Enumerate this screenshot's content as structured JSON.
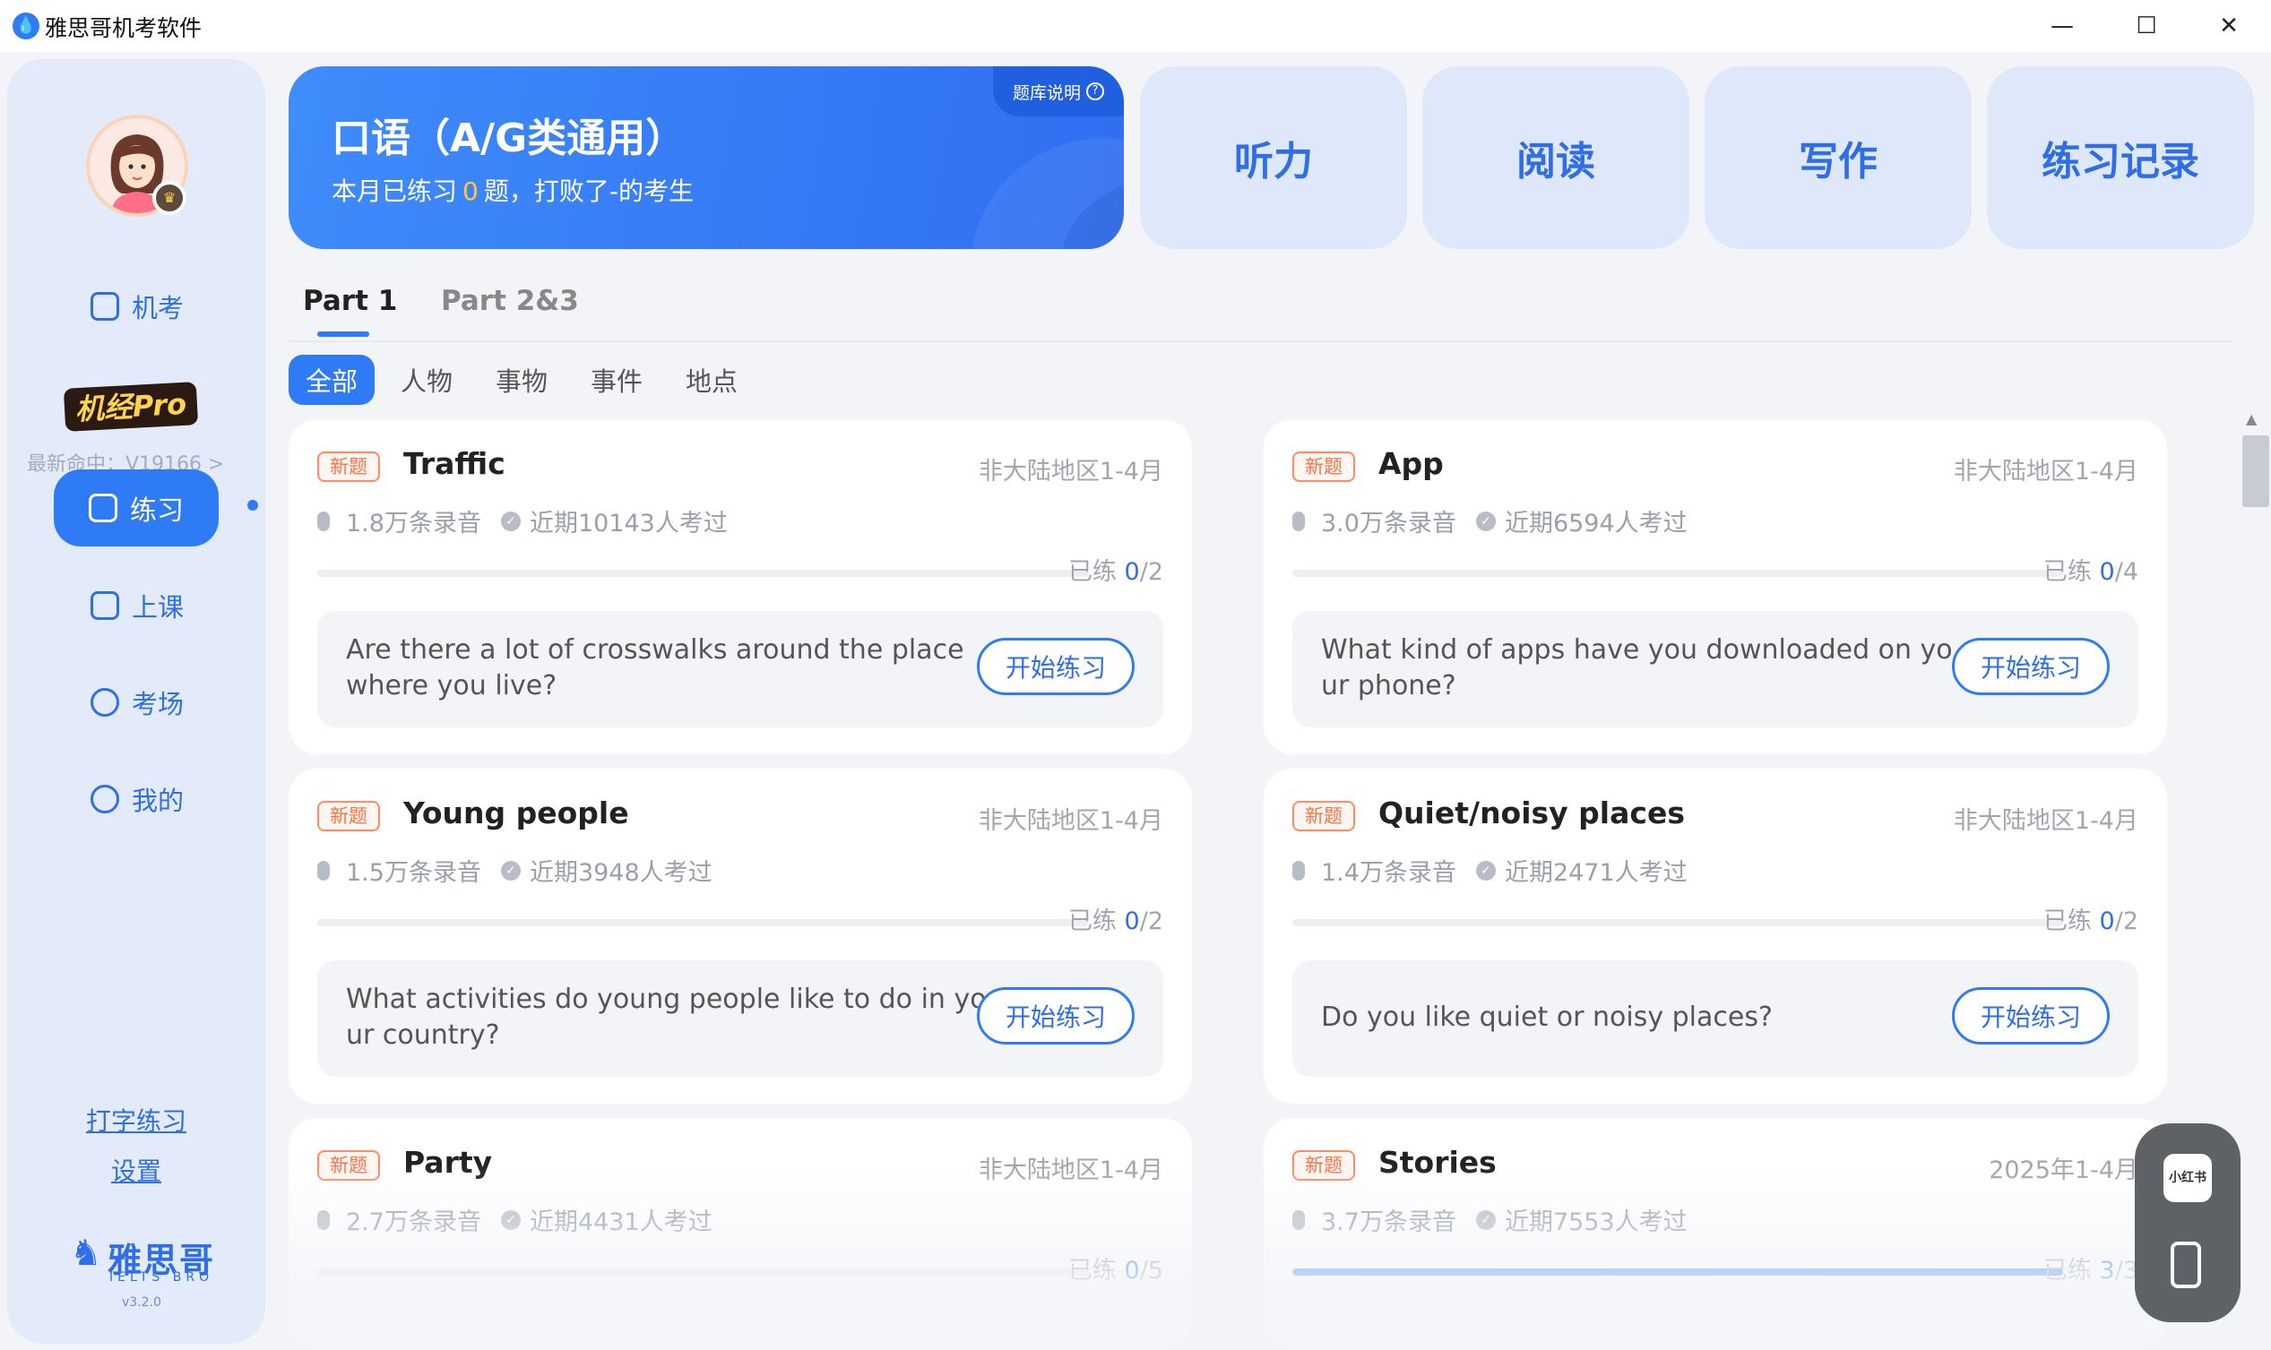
{
  "window": {
    "title": "雅思哥机考软件",
    "minimize": "—",
    "maximize": "☐",
    "close": "✕"
  },
  "sidebar": {
    "nav": [
      {
        "label": "机考",
        "icon": "monitor-icon"
      },
      {
        "label": "练习",
        "icon": "edit-icon",
        "active": true
      },
      {
        "label": "上课",
        "icon": "tv-icon"
      },
      {
        "label": "考场",
        "icon": "chat-icon"
      },
      {
        "label": "我的",
        "icon": "smile-icon"
      }
    ],
    "pro_logo": "机经Pro",
    "latest_hit": "最新命中：V19166 >",
    "links": {
      "typing": "打字练习",
      "settings": "设置"
    },
    "brand": {
      "name": "雅思哥",
      "sub": "IELTS BRO",
      "version": "v3.2.0"
    }
  },
  "hero": {
    "title": "口语（A/G类通用）",
    "sub_prefix": "本月已练习",
    "count": "0",
    "sub_suffix": "题，打败了-的考生",
    "help": "题库说明"
  },
  "categories": [
    "听力",
    "阅读",
    "写作",
    "练习记录"
  ],
  "tabs": [
    "Part 1",
    "Part 2&3"
  ],
  "filters": [
    "全部",
    "人物",
    "事物",
    "事件",
    "地点"
  ],
  "cards": [
    {
      "tag": "新题",
      "title": "Traffic",
      "region": "非大陆地区1-4月",
      "recordings": "1.8万条录音",
      "takers": "近期10143人考过",
      "done_label": "已练 ",
      "done": "0",
      "total": "/2",
      "progress": 0,
      "question": "Are there a lot of crosswalks around the place where you live?",
      "button": "开始练习"
    },
    {
      "tag": "新题",
      "title": "App",
      "region": "非大陆地区1-4月",
      "recordings": "3.0万条录音",
      "takers": "近期6594人考过",
      "done_label": "已练 ",
      "done": "0",
      "total": "/4",
      "progress": 0,
      "question": "What kind of apps have you downloaded on your phone?",
      "button": "开始练习"
    },
    {
      "tag": "新题",
      "title": "Young people",
      "region": "非大陆地区1-4月",
      "recordings": "1.5万条录音",
      "takers": "近期3948人考过",
      "done_label": "已练 ",
      "done": "0",
      "total": "/2",
      "progress": 0,
      "question": "What activities do young people like to do in your country?",
      "button": "开始练习"
    },
    {
      "tag": "新题",
      "title": "Quiet/noisy places",
      "region": "非大陆地区1-4月",
      "recordings": "1.4万条录音",
      "takers": "近期2471人考过",
      "done_label": "已练 ",
      "done": "0",
      "total": "/2",
      "progress": 0,
      "question": "Do you like quiet or noisy places?",
      "button": "开始练习"
    },
    {
      "tag": "新题",
      "title": "Party",
      "region": "非大陆地区1-4月",
      "recordings": "2.7万条录音",
      "takers": "近期4431人考过",
      "done_label": "已练 ",
      "done": "0",
      "total": "/5",
      "progress": 0
    },
    {
      "tag": "新题",
      "title": "Stories",
      "region": "2025年1-4月",
      "recordings": "3.7万条录音",
      "takers": "近期7553人考过",
      "done_label": "已练 ",
      "done": "3",
      "total": "/3",
      "progress": 1
    }
  ],
  "float_widget": {
    "xhs": "小红书"
  }
}
